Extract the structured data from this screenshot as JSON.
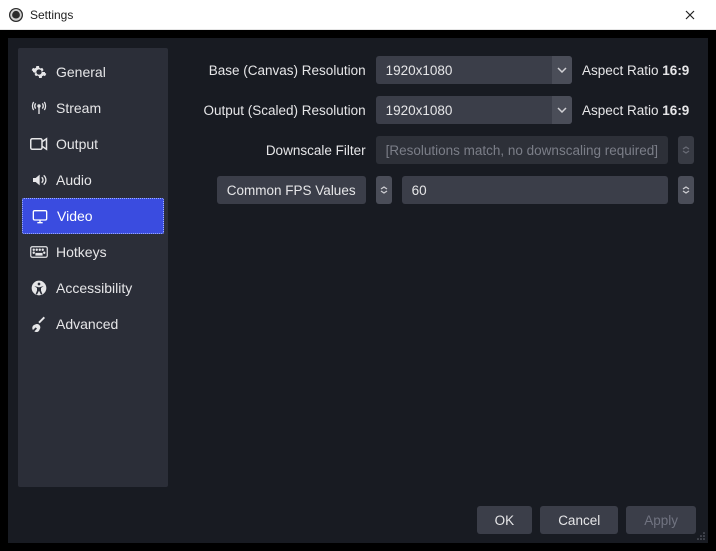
{
  "window": {
    "title": "Settings"
  },
  "sidebar": {
    "items": [
      {
        "label": "General"
      },
      {
        "label": "Stream"
      },
      {
        "label": "Output"
      },
      {
        "label": "Audio"
      },
      {
        "label": "Video"
      },
      {
        "label": "Hotkeys"
      },
      {
        "label": "Accessibility"
      },
      {
        "label": "Advanced"
      }
    ],
    "active_index": 4
  },
  "video": {
    "base_label": "Base (Canvas) Resolution",
    "base_value": "1920x1080",
    "base_aspect_prefix": "Aspect Ratio ",
    "base_aspect_value": "16:9",
    "output_label": "Output (Scaled) Resolution",
    "output_value": "1920x1080",
    "output_aspect_prefix": "Aspect Ratio ",
    "output_aspect_value": "16:9",
    "downscale_label": "Downscale Filter",
    "downscale_value": "[Resolutions match, no downscaling required]",
    "fps_mode_label": "Common FPS Values",
    "fps_value": "60"
  },
  "footer": {
    "ok": "OK",
    "cancel": "Cancel",
    "apply": "Apply"
  }
}
